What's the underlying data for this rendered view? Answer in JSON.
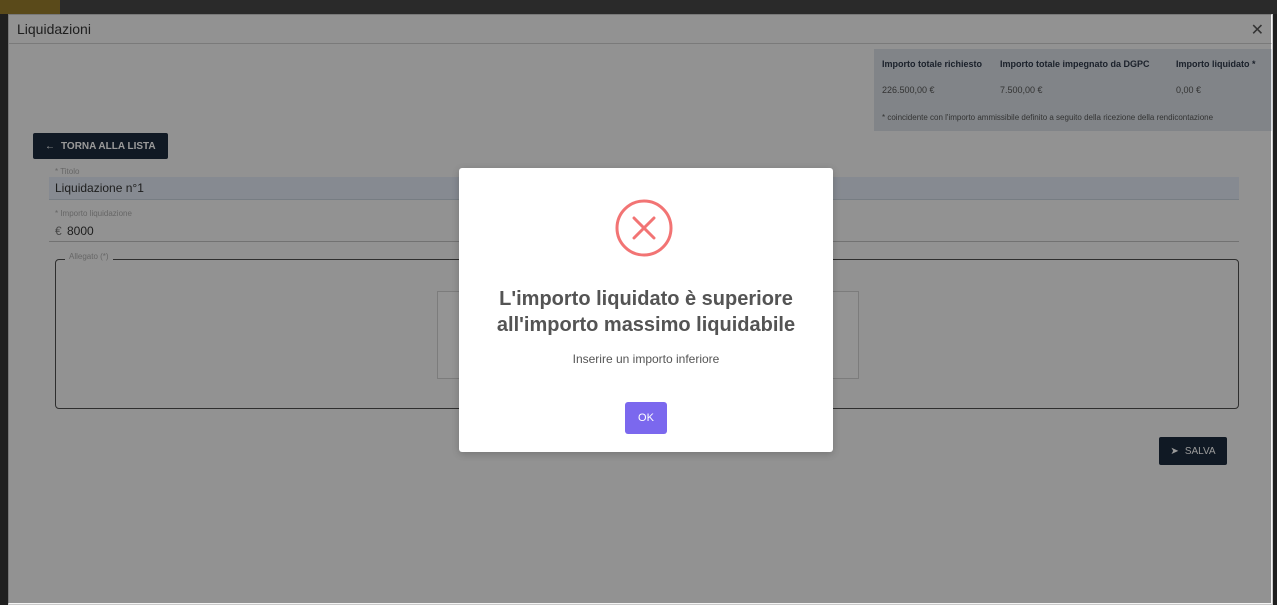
{
  "window": {
    "title": "Liquidazioni",
    "close_icon": "close-icon"
  },
  "summary": {
    "headers": [
      "Importo totale richiesto",
      "Importo totale impegnato da DGPC",
      "Importo liquidato *"
    ],
    "values": [
      "226.500,00 €",
      "7.500,00 €",
      "0,00 €"
    ],
    "note": "* coincidente con l'importo ammissibile definito a seguito della ricezione della rendicontazione"
  },
  "buttons": {
    "back_label": "TORNA ALLA LISTA",
    "save_label": "SALVA"
  },
  "form": {
    "title_label": "* Titolo",
    "title_value": "Liquidazione n°1",
    "amount_label": "* Importo liquidazione",
    "currency": "€",
    "amount_value": "8000",
    "attachment_label": "Allegato (*)"
  },
  "modal": {
    "icon": "error-x-icon",
    "title_line1": "L'importo liquidato è superiore",
    "title_line2": "all'importo massimo liquidabile",
    "text": "Inserire un importo inferiore",
    "ok_label": "OK",
    "accent": "#7b68ee",
    "error_color": "#f27474"
  }
}
